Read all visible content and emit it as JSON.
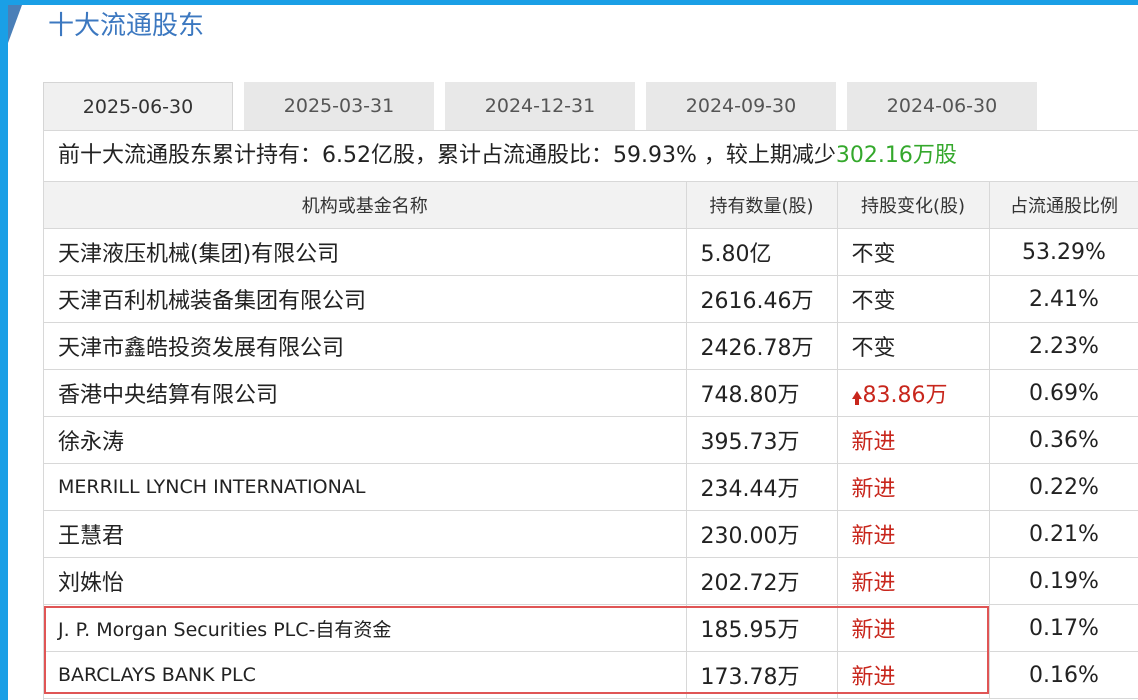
{
  "section_title": "十大流通股东",
  "tabs": [
    {
      "label": "2025-06-30",
      "active": true
    },
    {
      "label": "2025-03-31",
      "active": false
    },
    {
      "label": "2024-12-31",
      "active": false
    },
    {
      "label": "2024-09-30",
      "active": false
    },
    {
      "label": "2024-06-30",
      "active": false
    }
  ],
  "summary": {
    "prefix": "前十大流通股东累计持有：",
    "total_shares": "6.52亿股",
    "ratio_label": "，累计占流通股比：",
    "ratio": "59.93%",
    "change_label": " ，较上期减少",
    "change_value": "302.16万股"
  },
  "table": {
    "headers": [
      "机构或基金名称",
      "持有数量(股)",
      "持股变化(股)",
      "占流通股比例"
    ],
    "rows": [
      {
        "name": "天津液压机械(集团)有限公司",
        "shares": "5.80亿",
        "change": "不变",
        "pct": "53.29%"
      },
      {
        "name": "天津百利机械装备集团有限公司",
        "shares": "2616.46万",
        "change": "不变",
        "pct": "2.41%"
      },
      {
        "name": "天津市鑫皓投资发展有限公司",
        "shares": "2426.78万",
        "change": "不变",
        "pct": "2.23%"
      },
      {
        "name": "香港中央结算有限公司",
        "shares": "748.80万",
        "change": "83.86万",
        "pct": "0.69%"
      },
      {
        "name": "徐永涛",
        "shares": "395.73万",
        "change": "新进",
        "pct": "0.36%"
      },
      {
        "name": "MERRILL LYNCH INTERNATIONAL",
        "shares": "234.44万",
        "change": "新进",
        "pct": "0.22%"
      },
      {
        "name": "王慧君",
        "shares": "230.00万",
        "change": "新进",
        "pct": "0.21%"
      },
      {
        "name": "刘姝怡",
        "shares": "202.72万",
        "change": "新进",
        "pct": "0.19%"
      },
      {
        "name": "J. P. Morgan Securities PLC-自有资金",
        "shares": "185.95万",
        "change": "新进",
        "pct": "0.17%"
      },
      {
        "name": "BARCLAYS BANK PLC",
        "shares": "173.78万",
        "change": "新进",
        "pct": "0.16%"
      }
    ]
  },
  "colors": {
    "accent_blue": "#3c78c0",
    "increase_red": "#c8261c",
    "decrease_green": "#34a82c",
    "highlight_border": "#e05555"
  }
}
